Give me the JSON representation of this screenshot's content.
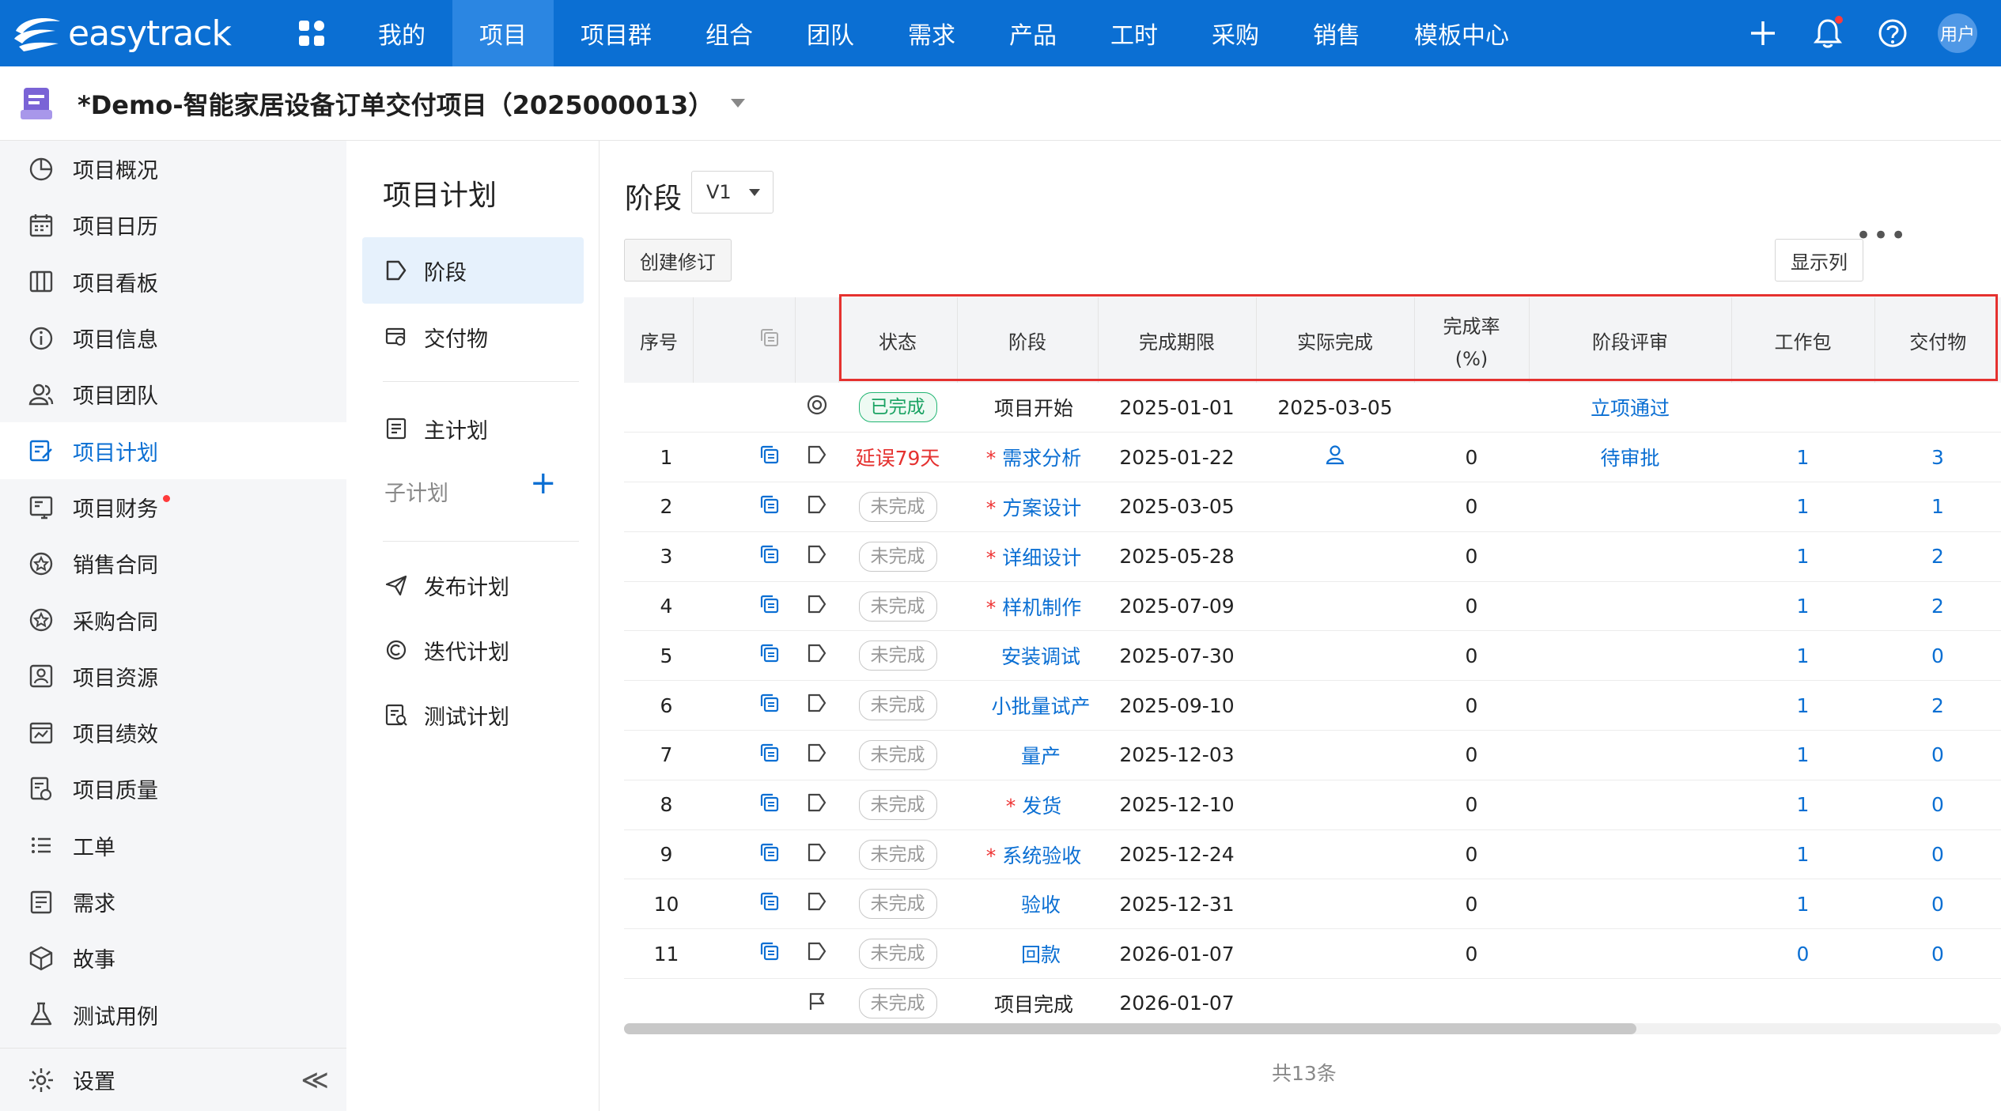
{
  "app": {
    "logo_text": "easytrack",
    "brand_color": "#0b6fd3"
  },
  "topnav": {
    "items": [
      {
        "label": "我的",
        "active": false
      },
      {
        "label": "项目",
        "active": true
      },
      {
        "label": "项目群",
        "active": false
      },
      {
        "label": "组合",
        "active": false
      },
      {
        "label": "团队",
        "active": false
      },
      {
        "label": "需求",
        "active": false
      },
      {
        "label": "产品",
        "active": false
      },
      {
        "label": "工时",
        "active": false
      },
      {
        "label": "采购",
        "active": false
      },
      {
        "label": "销售",
        "active": false
      },
      {
        "label": "模板中心",
        "active": false
      }
    ],
    "avatar_label": "用户"
  },
  "project": {
    "title": "*Demo-智能家居设备订单交付项目（2025000013）"
  },
  "sidebar": {
    "items": [
      {
        "label": "项目概况",
        "icon": "pie-chart-icon"
      },
      {
        "label": "项目日历",
        "icon": "calendar-icon"
      },
      {
        "label": "项目看板",
        "icon": "kanban-icon"
      },
      {
        "label": "项目信息",
        "icon": "info-icon"
      },
      {
        "label": "项目团队",
        "icon": "team-icon"
      },
      {
        "label": "项目计划",
        "icon": "plan-icon",
        "active": true
      },
      {
        "label": "项目财务",
        "icon": "finance-icon",
        "dot": true
      },
      {
        "label": "销售合同",
        "icon": "sales-contract-icon"
      },
      {
        "label": "采购合同",
        "icon": "purchase-contract-icon"
      },
      {
        "label": "项目资源",
        "icon": "resource-icon"
      },
      {
        "label": "项目绩效",
        "icon": "performance-icon"
      },
      {
        "label": "项目质量",
        "icon": "quality-icon"
      },
      {
        "label": "工单",
        "icon": "list-icon"
      },
      {
        "label": "需求",
        "icon": "requirement-icon"
      },
      {
        "label": "故事",
        "icon": "cube-icon"
      },
      {
        "label": "测试用例",
        "icon": "flask-icon"
      }
    ],
    "settings_label": "设置",
    "collapse_label": "≪"
  },
  "plan_panel": {
    "heading": "项目计划",
    "stage_label": "阶段",
    "deliverable_label": "交付物",
    "master_plan_label": "主计划",
    "subplan_label": "子计划",
    "add_label": "+",
    "release_plan_label": "发布计划",
    "iteration_plan_label": "迭代计划",
    "test_plan_label": "测试计划"
  },
  "main": {
    "title": "阶段",
    "version": "V1",
    "create_revision_label": "创建修订",
    "show_columns_label": "显示列",
    "more_label": "•••",
    "total_label": "共13条"
  },
  "table": {
    "columns": {
      "seq": "序号",
      "status": "状态",
      "stage": "阶段",
      "deadline": "完成期限",
      "actual": "实际完成",
      "rate_line1": "完成率",
      "rate_line2": "(%)",
      "review": "阶段评审",
      "workpackage": "工作包",
      "deliverable": "交付物"
    },
    "rows": [
      {
        "seq": "",
        "type": "start",
        "status": "已完成",
        "status_kind": "done",
        "required": false,
        "stage": "项目开始",
        "stage_link": false,
        "deadline": "2025-01-01",
        "actual": "2025-03-05",
        "rate": "",
        "review": "立项通过",
        "wp": "",
        "deliv": ""
      },
      {
        "seq": "1",
        "type": "stage",
        "status": "延误79天",
        "status_kind": "delay",
        "required": true,
        "stage": "需求分析",
        "stage_link": true,
        "deadline": "2025-01-22",
        "actual": "",
        "actual_icon": true,
        "rate": "0",
        "review": "待审批",
        "wp": "1",
        "deliv": "3"
      },
      {
        "seq": "2",
        "type": "stage",
        "status": "未完成",
        "status_kind": "todo",
        "required": true,
        "stage": "方案设计",
        "stage_link": true,
        "deadline": "2025-03-05",
        "actual": "",
        "rate": "0",
        "review": "",
        "wp": "1",
        "deliv": "1"
      },
      {
        "seq": "3",
        "type": "stage",
        "status": "未完成",
        "status_kind": "todo",
        "required": true,
        "stage": "详细设计",
        "stage_link": true,
        "deadline": "2025-05-28",
        "actual": "",
        "rate": "0",
        "review": "",
        "wp": "1",
        "deliv": "2"
      },
      {
        "seq": "4",
        "type": "stage",
        "status": "未完成",
        "status_kind": "todo",
        "required": true,
        "stage": "样机制作",
        "stage_link": true,
        "deadline": "2025-07-09",
        "actual": "",
        "rate": "0",
        "review": "",
        "wp": "1",
        "deliv": "2"
      },
      {
        "seq": "5",
        "type": "stage",
        "status": "未完成",
        "status_kind": "todo",
        "required": false,
        "stage": "安装调试",
        "stage_link": true,
        "deadline": "2025-07-30",
        "actual": "",
        "rate": "0",
        "review": "",
        "wp": "1",
        "deliv": "0"
      },
      {
        "seq": "6",
        "type": "stage",
        "status": "未完成",
        "status_kind": "todo",
        "required": false,
        "stage": "小批量试产",
        "stage_link": true,
        "deadline": "2025-09-10",
        "actual": "",
        "rate": "0",
        "review": "",
        "wp": "1",
        "deliv": "2"
      },
      {
        "seq": "7",
        "type": "stage",
        "status": "未完成",
        "status_kind": "todo",
        "required": false,
        "stage": "量产",
        "stage_link": true,
        "deadline": "2025-12-03",
        "actual": "",
        "rate": "0",
        "review": "",
        "wp": "1",
        "deliv": "0"
      },
      {
        "seq": "8",
        "type": "stage",
        "status": "未完成",
        "status_kind": "todo",
        "required": true,
        "stage": "发货",
        "stage_link": true,
        "deadline": "2025-12-10",
        "actual": "",
        "rate": "0",
        "review": "",
        "wp": "1",
        "deliv": "0"
      },
      {
        "seq": "9",
        "type": "stage",
        "status": "未完成",
        "status_kind": "todo",
        "required": true,
        "stage": "系统验收",
        "stage_link": true,
        "deadline": "2025-12-24",
        "actual": "",
        "rate": "0",
        "review": "",
        "wp": "1",
        "deliv": "0"
      },
      {
        "seq": "10",
        "type": "stage",
        "status": "未完成",
        "status_kind": "todo",
        "required": false,
        "stage": "验收",
        "stage_link": true,
        "deadline": "2025-12-31",
        "actual": "",
        "rate": "0",
        "review": "",
        "wp": "1",
        "deliv": "0"
      },
      {
        "seq": "11",
        "type": "stage",
        "status": "未完成",
        "status_kind": "todo",
        "required": false,
        "stage": "回款",
        "stage_link": true,
        "deadline": "2026-01-07",
        "actual": "",
        "rate": "0",
        "review": "",
        "wp": "0",
        "deliv": "0"
      },
      {
        "seq": "",
        "type": "end",
        "status": "未完成",
        "status_kind": "todo",
        "required": false,
        "stage": "项目完成",
        "stage_link": false,
        "deadline": "2026-01-07",
        "actual": "",
        "rate": "",
        "review": "",
        "wp": "",
        "deliv": ""
      }
    ]
  }
}
